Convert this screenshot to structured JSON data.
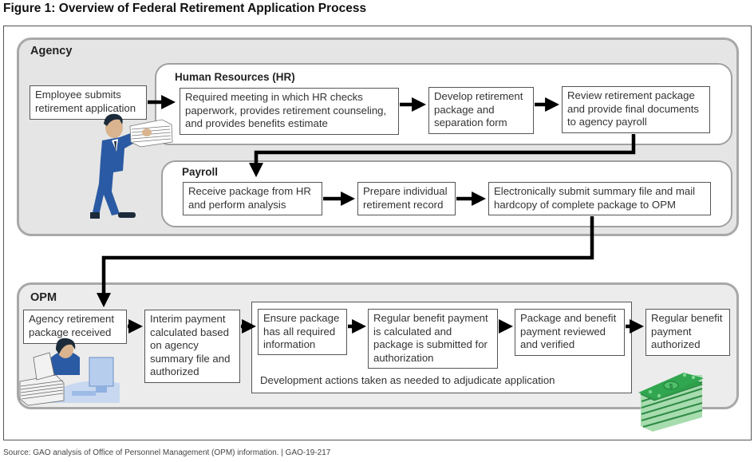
{
  "figure": {
    "title": "Figure 1: Overview of Federal Retirement Application Process",
    "source": "Source: GAO analysis of Office of Personnel Management (OPM) information.  |  GAO-19-217"
  },
  "agency": {
    "label": "Agency",
    "employee_step": "Employee submits retirement application",
    "hr": {
      "label": "Human Resources (HR)",
      "steps": [
        "Required meeting in which HR checks paperwork, provides retirement counseling, and provides benefits estimate",
        "Develop retirement package and separation form",
        "Review retirement package and provide final documents to agency payroll"
      ]
    },
    "payroll": {
      "label": "Payroll",
      "steps": [
        "Receive package from HR and perform analysis",
        "Prepare individual retirement record",
        "Electronically submit summary file and mail hardcopy of complete package to OPM"
      ]
    }
  },
  "opm": {
    "label": "OPM",
    "steps": [
      "Agency retirement package received",
      "Interim payment calculated based on agency summary file and authorized",
      "Ensure package has all required information",
      "Regular benefit payment is calculated and package is submitted for authorization",
      "Package and benefit payment reviewed and verified",
      "Regular benefit payment authorized"
    ],
    "development_note": "Development actions taken as needed to adjudicate application"
  },
  "icons": {
    "employee": "man-with-papers-icon",
    "opm_worker": "woman-at-desk-icon",
    "money": "money-stack-icon"
  },
  "colors": {
    "suit": "#2a5aa3",
    "money": "#2e9e4a",
    "panel_border": "#a8a8a8"
  }
}
